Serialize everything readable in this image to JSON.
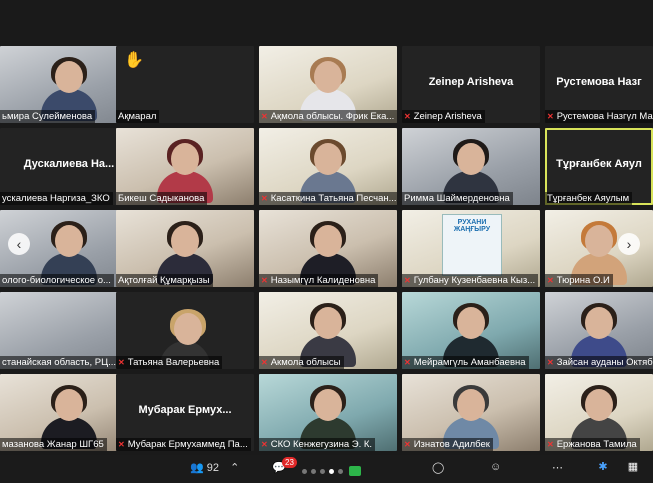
{
  "tiles": [
    {
      "label": "ьмира Сулейменова",
      "muted": false
    },
    {
      "label": "Ақмарал",
      "muted": false
    },
    {
      "label": "Ақмола облысы. Фрик Ека...",
      "muted": true
    },
    {
      "label": "Zeinep Arisheva",
      "big": "Zeinep Arisheva",
      "muted": true
    },
    {
      "label": "Рустемова Назгүл Ма",
      "big": "Рустемова Назг",
      "muted": true
    },
    {
      "label": "ускалиева Наргиза_ЗКО",
      "big": "Дускалиева На...",
      "muted": false
    },
    {
      "label": "Бикеш Садыканова",
      "muted": false
    },
    {
      "label": "Касаткина Татьяна Песчан...",
      "muted": true
    },
    {
      "label": "Римма Шаймерденовна",
      "muted": false
    },
    {
      "label": "Тұрғанбек Аяулым",
      "big": "Тұрғанбек Аяул",
      "muted": false
    },
    {
      "label": "олого-биологическое о...",
      "muted": false
    },
    {
      "label": "Ақтолғай Құмарқызы",
      "muted": false
    },
    {
      "label": "Назымгүл Калиденовна",
      "muted": true
    },
    {
      "label": "Гулбану Кузенбаевна Кыз...",
      "muted": true
    },
    {
      "label": "Тюрина О.И",
      "muted": true
    },
    {
      "label": "станайская область, РЦ...",
      "muted": false
    },
    {
      "label": "Татьяна Валерьевна",
      "muted": true
    },
    {
      "label": "Акмола облысы",
      "muted": true
    },
    {
      "label": "Мейрамгүль Аманбаевна",
      "muted": true
    },
    {
      "label": "Зайсан ауданы Октяб",
      "muted": true
    },
    {
      "label": "мазанова Жанар ШГ65",
      "muted": false
    },
    {
      "label": "Мубарак Ермухаммед Па...",
      "big": "Мубарак Ермух...",
      "muted": true
    },
    {
      "label": "СКО Кенжегузина Э. К.",
      "muted": true
    },
    {
      "label": "Изнатов Адилбек",
      "muted": true
    },
    {
      "label": "Ержанова Тамила",
      "muted": true
    }
  ],
  "slide": {
    "line1": "РУХАНИ",
    "line2": "ЖАҢҒЫРУ"
  },
  "toolbar": {
    "participants_count": "92",
    "chat_badge": "23",
    "nav_prev": "‹",
    "nav_next": "›"
  },
  "icons": {
    "hand": "raised-hand-icon",
    "mic_off": "mic-off-icon"
  },
  "colors": {
    "active_speaker": "#d8e35a",
    "mute": "#e33333",
    "share": "#2db54a",
    "badge": "#e02828"
  }
}
